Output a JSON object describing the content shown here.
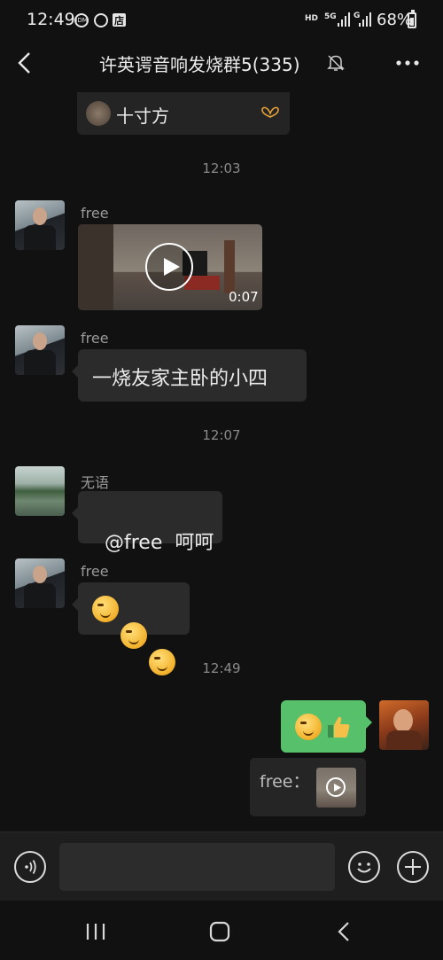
{
  "status_bar": {
    "time": "12:49",
    "icon_idm": "IDM",
    "icon_store": "店",
    "net_hd": "HD",
    "net_5g": "5G",
    "net_g": "G",
    "battery": "68%"
  },
  "header": {
    "title": "许英谔音响发烧群5(335)"
  },
  "messages": {
    "shared_card": {
      "label": "十寸方"
    },
    "timestamp_1": "12:03",
    "msg1": {
      "sender": "free",
      "video_duration": "0:07"
    },
    "msg2": {
      "sender": "free",
      "text": "一烧友家主卧的小四"
    },
    "timestamp_2": "12:07",
    "msg3": {
      "sender": "无语",
      "text": "@free  呵呵"
    },
    "msg4": {
      "sender": "free"
    },
    "timestamp_3": "12:49",
    "quote": {
      "text": "free："
    }
  },
  "colors": {
    "background": "#111111",
    "bubble_other": "#2b2b2b",
    "bubble_self": "#56c06b"
  },
  "icons": {
    "back": "chevron-left-icon",
    "mute": "bell-off-icon",
    "more": "ellipsis-icon",
    "voice": "voice-icon",
    "emoji": "emoji-icon",
    "add": "plus-icon"
  }
}
